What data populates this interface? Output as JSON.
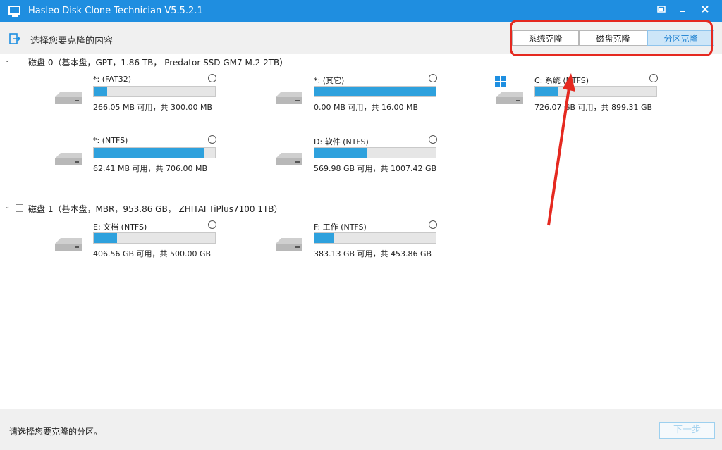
{
  "window": {
    "title": "Hasleo Disk Clone Technician V5.5.2.1"
  },
  "toolbar": {
    "prompt": "选择您要克隆的内容",
    "tabs": [
      {
        "label": "系统克隆",
        "active": false
      },
      {
        "label": "磁盘克隆",
        "active": false
      },
      {
        "label": "分区克隆",
        "active": true
      }
    ]
  },
  "disks": [
    {
      "header": "磁盘 0（基本盘，GPT，1.86 TB， Predator SSD GM7 M.2 2TB）",
      "partitions": [
        {
          "name": "*: (FAT32)",
          "usage": "266.05 MB 可用，共 300.00 MB",
          "used_fraction": 0.11,
          "system": false
        },
        {
          "name": "*: (其它)",
          "usage": "0.00 MB 可用，共 16.00 MB",
          "used_fraction": 1.0,
          "system": false
        },
        {
          "name": "C: 系统 (NTFS)",
          "usage": "726.07 GB 可用，共 899.31 GB",
          "used_fraction": 0.19,
          "system": true
        },
        {
          "name": "*: (NTFS)",
          "usage": "62.41 MB 可用，共 706.00 MB",
          "used_fraction": 0.91,
          "system": false
        },
        {
          "name": "D: 软件 (NTFS)",
          "usage": "569.98 GB 可用，共 1007.42 GB",
          "used_fraction": 0.43,
          "system": false
        }
      ]
    },
    {
      "header": "磁盘 1（基本盘，MBR，953.86 GB， ZHITAI TiPlus7100 1TB）",
      "partitions": [
        {
          "name": "E: 文档 (NTFS)",
          "usage": "406.56 GB 可用，共 500.00 GB",
          "used_fraction": 0.19,
          "system": false
        },
        {
          "name": "F: 工作 (NTFS)",
          "usage": "383.13 GB 可用，共 453.86 GB",
          "used_fraction": 0.16,
          "system": false
        }
      ]
    }
  ],
  "status": {
    "text": "请选择您要克隆的分区。",
    "next_label": "下一步"
  },
  "colors": {
    "accent": "#1f8ee0",
    "bar_fill": "#2ea1dd",
    "annotation": "#e52920"
  }
}
